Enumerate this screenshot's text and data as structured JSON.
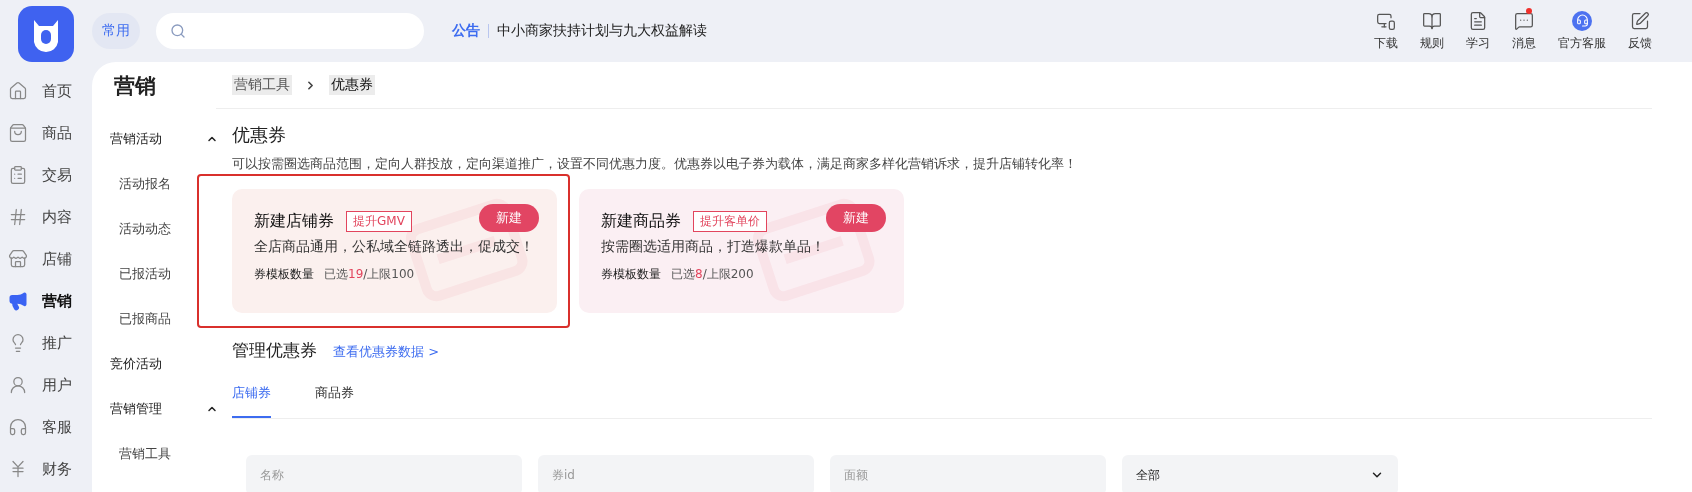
{
  "top_bar": {
    "shortcut": "常用",
    "notice": {
      "label": "公告",
      "text": "中小商家扶持计划与九大权益解读"
    },
    "actions": [
      {
        "label": "下载",
        "badge": false
      },
      {
        "label": "规则",
        "badge": false
      },
      {
        "label": "学习",
        "badge": false
      },
      {
        "label": "消息",
        "badge": true
      },
      {
        "label": "官方客服",
        "badge": false
      },
      {
        "label": "反馈",
        "badge": false
      }
    ]
  },
  "nav": [
    {
      "label": "首页",
      "selected": false
    },
    {
      "label": "商品",
      "selected": false
    },
    {
      "label": "交易",
      "selected": false
    },
    {
      "label": "内容",
      "selected": false
    },
    {
      "label": "店铺",
      "selected": false
    },
    {
      "label": "营销",
      "selected": true
    },
    {
      "label": "推广",
      "selected": false
    },
    {
      "label": "用户",
      "selected": false
    },
    {
      "label": "客服",
      "selected": false
    },
    {
      "label": "财务",
      "selected": false
    }
  ],
  "sub_nav": {
    "title": "营销",
    "items": [
      {
        "label": "营销活动",
        "expanded": true,
        "children": [
          {
            "label": "活动报名"
          },
          {
            "label": "活动动态"
          },
          {
            "label": "已报活动"
          },
          {
            "label": "已报商品"
          }
        ]
      },
      {
        "label": "竞价活动"
      },
      {
        "label": "营销管理",
        "expanded": true,
        "children": [
          {
            "label": "营销工具"
          }
        ]
      }
    ]
  },
  "breadcrumb": [
    "营销工具",
    "优惠券"
  ],
  "page": {
    "title": "优惠券",
    "description": "可以按需圈选商品范围，定向人群投放，定向渠道推广，设置不同优惠力度。优惠券以电子券为载体，满足商家多样化营销诉求，提升店铺转化率！"
  },
  "cards": [
    {
      "title": "新建店铺券",
      "tag": "提升GMV",
      "button": "新建",
      "description": "全店商品通用，公私域全链路透出，促成交！",
      "quota_label": "券模板数量",
      "quota": {
        "prefix": "已选",
        "count": "19",
        "suffix": "/上限100"
      },
      "highlighted": true,
      "color": "#fbf0ee"
    },
    {
      "title": "新建商品券",
      "tag": "提升客单价",
      "button": "新建",
      "description": "按需圈选适用商品，打造爆款单品！",
      "quota_label": "券模板数量",
      "quota": {
        "prefix": "已选",
        "count": "8",
        "suffix": "/上限200"
      },
      "highlighted": false,
      "color": "#fbeff3"
    }
  ],
  "manage": {
    "title": "管理优惠券",
    "link": "查看优惠券数据 >",
    "tabs": [
      {
        "label": "店铺券",
        "selected": true
      },
      {
        "label": "商品券",
        "selected": false
      }
    ],
    "filters": [
      {
        "kind": "input",
        "placeholder": "名称"
      },
      {
        "kind": "input",
        "placeholder": "券id"
      },
      {
        "kind": "input",
        "placeholder": "面额"
      },
      {
        "kind": "select",
        "value": "全部"
      }
    ]
  }
}
